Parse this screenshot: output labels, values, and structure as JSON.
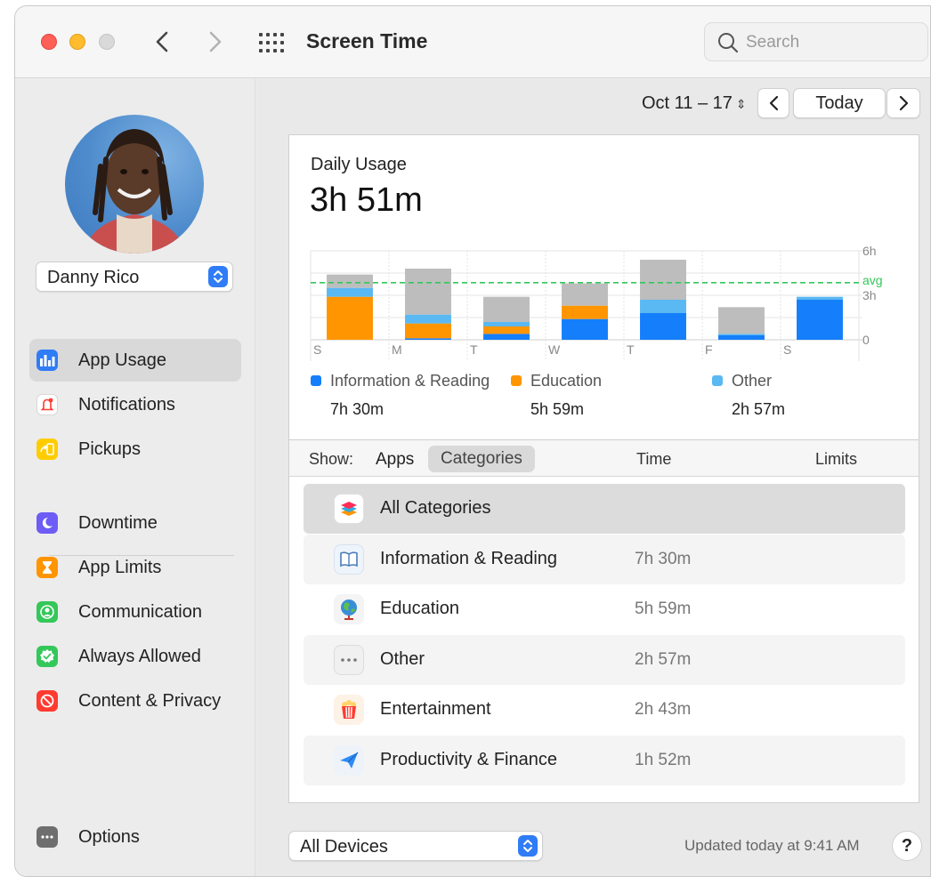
{
  "window": {
    "title": "Screen Time"
  },
  "search": {
    "placeholder": "Search"
  },
  "sidebar": {
    "user": "Danny Rico",
    "items": [
      {
        "label": "App Usage",
        "icon": "bar-chart-icon",
        "color": "#2f7cf6",
        "active": true
      },
      {
        "label": "Notifications",
        "icon": "bell-icon",
        "color": "#ffffff"
      },
      {
        "label": "Pickups",
        "icon": "pickup-icon",
        "color": "#ffcc00"
      },
      {
        "label": "Downtime",
        "icon": "downtime-icon",
        "color": "#6e5cf6"
      },
      {
        "label": "App Limits",
        "icon": "hourglass-icon",
        "color": "#ff9500"
      },
      {
        "label": "Communication",
        "icon": "person-icon",
        "color": "#34c759"
      },
      {
        "label": "Always Allowed",
        "icon": "checkmark-badge-icon",
        "color": "#34c759"
      },
      {
        "label": "Content & Privacy",
        "icon": "no-entry-icon",
        "color": "#ff3b30"
      }
    ],
    "options_label": "Options"
  },
  "toolbar": {
    "date_range": "Oct 11 – 17",
    "today_label": "Today"
  },
  "usage": {
    "caption": "Daily Usage",
    "total": "3h 51m"
  },
  "chart_data": {
    "type": "bar",
    "stacked": true,
    "categories": [
      "S",
      "M",
      "T",
      "W",
      "T",
      "F",
      "S"
    ],
    "y_axis_ticks": [
      "0",
      "3h",
      "6h"
    ],
    "ylim": [
      0,
      6
    ],
    "avg_label": "avg",
    "avg_value": 3.85,
    "series": [
      {
        "name": "Information & Reading",
        "color": "#157efb",
        "values": [
          0.0,
          0.1,
          0.4,
          1.4,
          1.8,
          0.3,
          2.7
        ]
      },
      {
        "name": "Education",
        "color": "#ff9500",
        "values": [
          2.9,
          1.0,
          0.5,
          0.9,
          0.0,
          0.0,
          0.0
        ]
      },
      {
        "name": "Other",
        "color": "#5ab8f2",
        "values": [
          0.6,
          0.6,
          0.3,
          0.0,
          0.9,
          0.1,
          0.2
        ]
      },
      {
        "name": "",
        "color": "#bdbdbd",
        "values": [
          0.9,
          3.1,
          1.7,
          1.5,
          2.7,
          1.8,
          0.0
        ]
      }
    ]
  },
  "legend": [
    {
      "name": "Information & Reading",
      "value": "7h 30m",
      "color": "#157efb"
    },
    {
      "name": "Education",
      "value": "5h 59m",
      "color": "#ff9500"
    },
    {
      "name": "Other",
      "value": "2h 57m",
      "color": "#5ab8f2"
    }
  ],
  "list_header": {
    "show": "Show:",
    "apps": "Apps",
    "categories": "Categories",
    "time": "Time",
    "limits": "Limits"
  },
  "rows": [
    {
      "name": "All Categories",
      "time": "",
      "icon": "stack-icon"
    },
    {
      "name": "Information & Reading",
      "time": "7h 30m",
      "icon": "book-icon"
    },
    {
      "name": "Education",
      "time": "5h 59m",
      "icon": "globe-icon"
    },
    {
      "name": "Other",
      "time": "2h 57m",
      "icon": "ellipsis-icon"
    },
    {
      "name": "Entertainment",
      "time": "2h 43m",
      "icon": "popcorn-icon"
    },
    {
      "name": "Productivity & Finance",
      "time": "1h 52m",
      "icon": "paper-plane-icon"
    }
  ],
  "footer": {
    "device": "All Devices",
    "updated": "Updated today at 9:41 AM",
    "help": "?"
  }
}
